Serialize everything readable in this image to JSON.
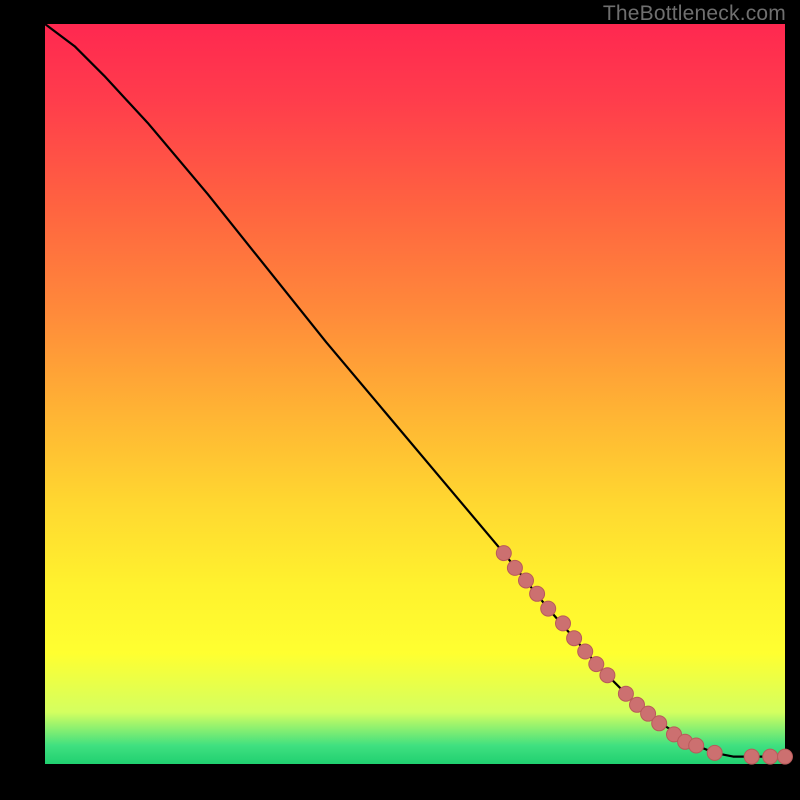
{
  "watermark": "TheBottleneck.com",
  "chart_data": {
    "type": "line",
    "title": "",
    "xlabel": "",
    "ylabel": "",
    "xlim": [
      0,
      100
    ],
    "ylim": [
      0,
      100
    ],
    "series": [
      {
        "name": "curve",
        "style": "solid-black",
        "x": [
          0,
          4,
          8,
          14,
          22,
          30,
          38,
          46,
          54,
          62,
          68,
          75,
          80,
          84,
          88,
          90.5,
          93,
          95.5,
          98,
          100
        ],
        "y": [
          100,
          97,
          93,
          86.5,
          77,
          67,
          57,
          47.5,
          38,
          28.5,
          21,
          13,
          8,
          5,
          2.5,
          1.5,
          1,
          1,
          1,
          1
        ]
      },
      {
        "name": "highlight-dots",
        "style": "salmon-dots",
        "x": [
          62,
          63.5,
          65,
          66.5,
          68,
          70,
          71.5,
          73,
          74.5,
          76,
          78.5,
          80,
          81.5,
          83,
          85,
          86.5,
          88,
          90.5,
          95.5,
          98,
          100
        ],
        "y": [
          28.5,
          26.5,
          24.8,
          23,
          21,
          19,
          17,
          15.2,
          13.5,
          12,
          9.5,
          8,
          6.8,
          5.5,
          4,
          3,
          2.5,
          1.5,
          1,
          1,
          1
        ]
      }
    ],
    "colors": {
      "line": "#000000",
      "dots_fill": "#cc7070",
      "dots_stroke": "#b85a5a",
      "top_gradient": "#ff2850",
      "mid_gradient": "#ffe030",
      "bottom_gradient": "#20d070",
      "frame": "#000000"
    }
  }
}
